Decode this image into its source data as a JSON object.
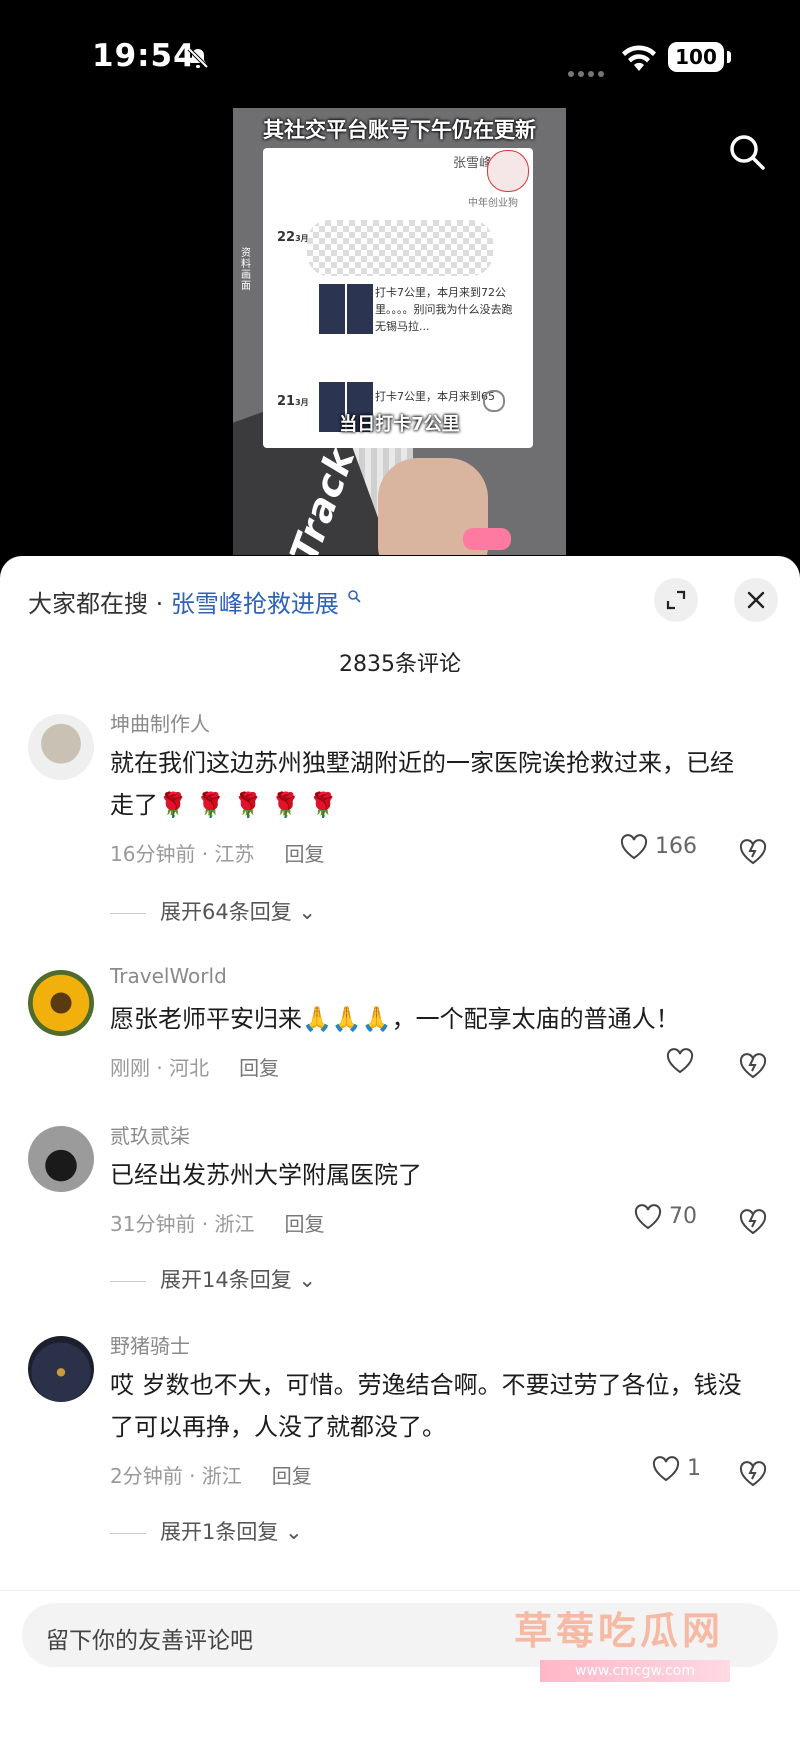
{
  "status_bar": {
    "time": "19:54",
    "battery": "100"
  },
  "video": {
    "caption_top": "其社交平台账号下午仍在更新",
    "caption_bottom": "当日打卡7公里",
    "brand_text": "Track",
    "side_text": "资料画面",
    "post_card": {
      "name": "张雪峰",
      "subtitle": "中年创业狗",
      "date1": "22",
      "date1_month": "3月",
      "text1": "打卡7公里，本月来到72公里。。。。别问我为什么没去跑无锡马拉...",
      "date2": "21",
      "date2_month": "3月",
      "text2": "打卡7公里，本月来到65"
    }
  },
  "sheet": {
    "hot_search_prefix": "大家都在搜 · ",
    "hot_search_keyword": "张雪峰抢救进展",
    "comment_count": "2835条评论"
  },
  "comments": [
    {
      "user": "坤曲制作人",
      "text": "就在我们这边苏州独墅湖附近的一家医院诶抢救过来，已经走了🌹 🌹 🌹 🌹 🌹",
      "meta": "16分钟前 · 江苏",
      "reply": "回复",
      "likes": "166",
      "expand": "展开64条回复"
    },
    {
      "user": "TravelWorld",
      "text": "愿张老师平安归来🙏🙏🙏，一个配享太庙的普通人！",
      "meta": "刚刚 · 河北",
      "reply": "回复",
      "likes": "",
      "expand": ""
    },
    {
      "user": "贰玖贰柒",
      "text": "已经出发苏州大学附属医院了",
      "meta": "31分钟前 · 浙江",
      "reply": "回复",
      "likes": "70",
      "expand": "展开14条回复"
    },
    {
      "user": "野猪骑士",
      "text": "哎 岁数也不大，可惜。劳逸结合啊。不要过劳了各位，钱没了可以再挣，人没了就都没了。",
      "meta": "2分钟前 · 浙江",
      "reply": "回复",
      "likes": "1",
      "expand": "展开1条回复"
    }
  ],
  "input": {
    "placeholder": "留下你的友善评论吧"
  },
  "watermark": {
    "text": "草莓吃瓜网",
    "url": "www.cmcgw.com"
  },
  "colors": {
    "keyword": "#2f63b8",
    "sheet_bg": "#ffffff",
    "page_bg": "#000000"
  }
}
